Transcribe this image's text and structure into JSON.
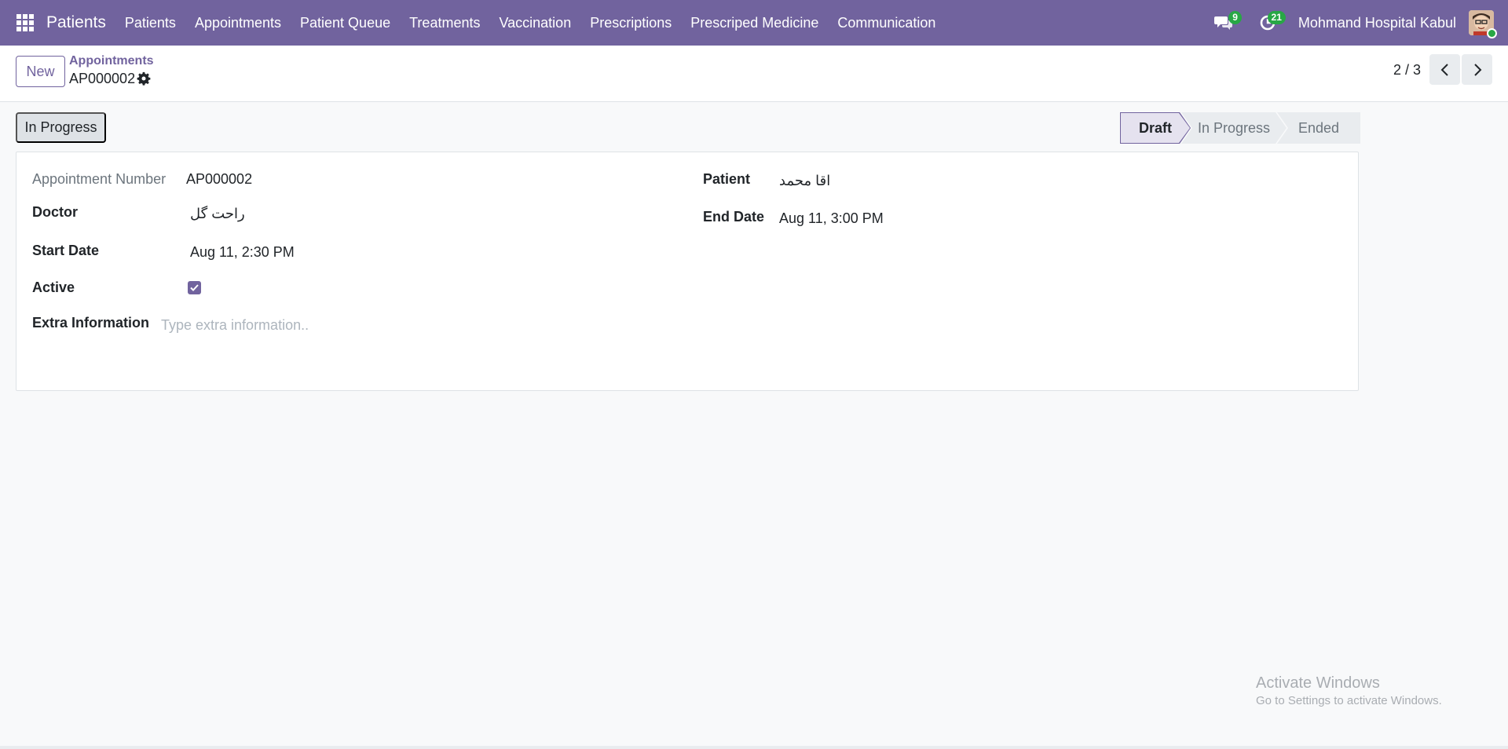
{
  "navbar": {
    "brand": "Patients",
    "menu": [
      "Patients",
      "Appointments",
      "Patient Queue",
      "Treatments",
      "Vaccination",
      "Prescriptions",
      "Prescriped Medicine",
      "Communication"
    ],
    "messages_count": "9",
    "activities_count": "21",
    "company": "Mohmand Hospital Kabul",
    "accent_color": "#71639e"
  },
  "control_panel": {
    "new_label": "New",
    "breadcrumb_parent": "Appointments",
    "record_name": "AP000002",
    "pager": "2 / 3"
  },
  "statusbar": {
    "action_label": "In Progress",
    "stages": [
      "Draft",
      "In Progress",
      "Ended"
    ],
    "active_stage": "Draft"
  },
  "form": {
    "appointment_number_label": "Appointment Number",
    "appointment_number": "AP000002",
    "doctor_label": "Doctor",
    "doctor": "راحت گل",
    "start_date_label": "Start Date",
    "start_date": "Aug 11, 2:30 PM",
    "active_label": "Active",
    "active": true,
    "extra_info_label": "Extra Information",
    "extra_info_placeholder": "Type extra information..",
    "patient_label": "Patient",
    "patient": "اقا محمد",
    "end_date_label": "End Date",
    "end_date": "Aug 11, 3:00 PM"
  },
  "watermark": {
    "title": "Activate Windows",
    "subtitle": "Go to Settings to activate Windows."
  }
}
